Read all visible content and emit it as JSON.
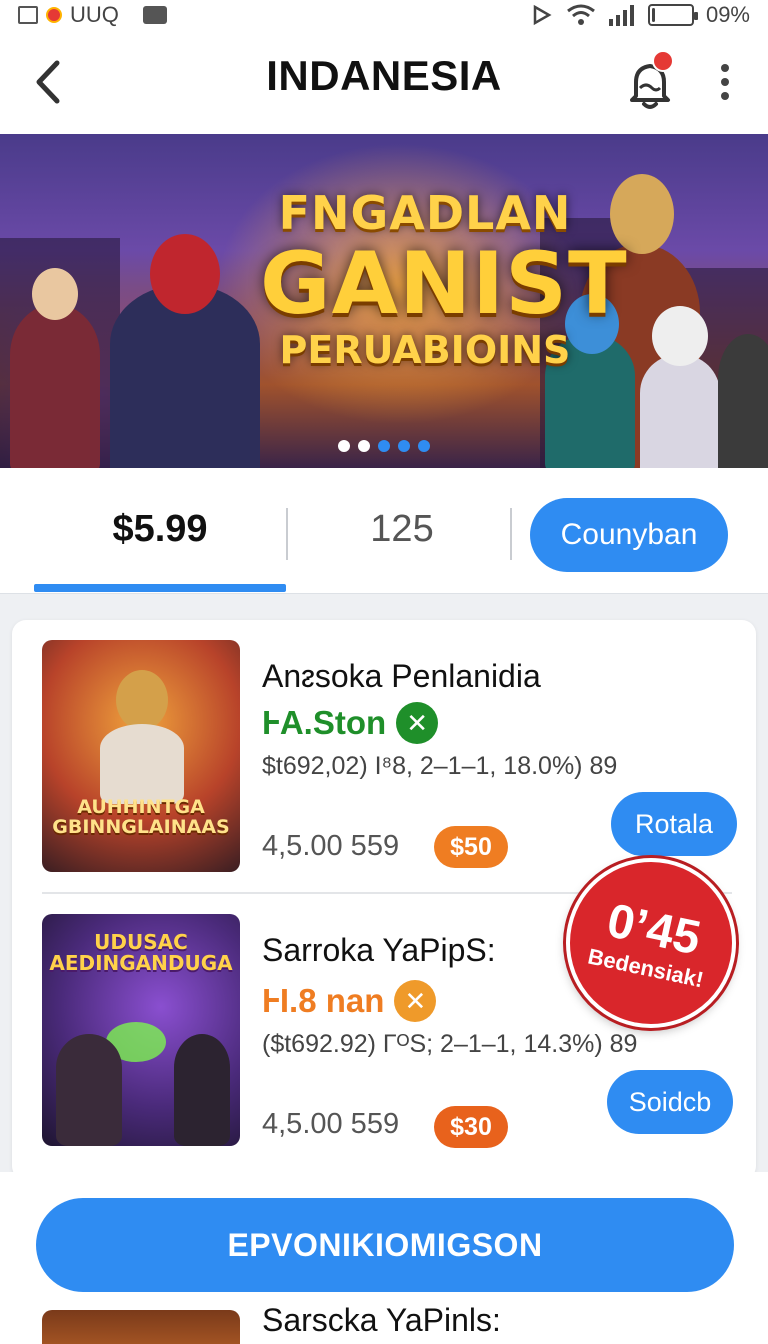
{
  "status_bar": {
    "left_text": "UUQ",
    "battery_text": "09%",
    "battery_level": 0.09
  },
  "header": {
    "title": "INDANESIA",
    "back_icon": "chevron-left-icon",
    "notification_icon": "bell-icon",
    "more_icon": "more-vertical-icon"
  },
  "banner": {
    "line1": "FNGADLAN",
    "line2": "GANIST",
    "line3": "PERUABIOINS",
    "dots_total": 5,
    "active_dot": 0
  },
  "tabs": {
    "price": "$5.99",
    "count": "125",
    "cta": "Counyban"
  },
  "items": [
    {
      "thumb_text": "AUHHINTGA GBINNGLAINAAS",
      "title": "Anᴤsoka Penlanidia",
      "status": "ⱵA.Ston",
      "status_icon": "close-circle-icon",
      "status_color": "#1f8f2a",
      "meta": "$t692,02) I⁸8, 2–1–1, 18.0%)  89",
      "metric": "4,5.00 559",
      "price_badge": "$50",
      "badge_color": "#ef7d22",
      "action": "Rotala"
    },
    {
      "thumb_text": "UDUSAC AEDINGANDUGA",
      "title": "Sarroka  YaPipS:",
      "status": "ⱵI.8 nan",
      "status_icon": "close-circle-icon",
      "status_color": "#ef7d22",
      "meta": "($t692.92) ΓᴼS; 2–1–1, 14.3%)  89",
      "metric": "4,5.00 559",
      "price_badge": "$30",
      "badge_color": "#e8621c",
      "action": "Soidcb"
    }
  ],
  "sticker": {
    "main": "0’45",
    "sub": "Bedensiak!"
  },
  "primary_cta": "EPVONIKIOMIGSON",
  "peek_item": {
    "title": "Sarscka  YaPinls:"
  },
  "colors": {
    "accent": "#2f8cf2",
    "sticker": "#d9262b"
  }
}
